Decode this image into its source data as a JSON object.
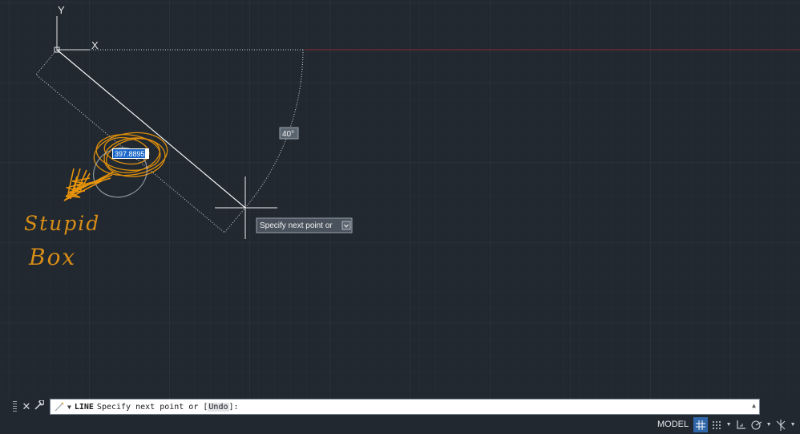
{
  "drawing": {
    "y_axis_label": "Y",
    "x_axis_label": "X",
    "angle_label": "40°",
    "length_input_value": "397.8895",
    "tooltip_text": "Specify next point or",
    "tooltip_icon": "arrow-down-icon",
    "annotation_line1": "Stupid",
    "annotation_line2": "Box",
    "annotation_color": "#e8940a"
  },
  "command_line": {
    "close_icon": "close-icon",
    "customize_icon": "wrench-icon",
    "command_icon": "pen-icon",
    "keyword": "LINE",
    "prompt": "Specify next point or [",
    "option": "Undo",
    "prompt_end": "]:"
  },
  "status_bar": {
    "model_label": "MODEL",
    "icons": [
      "grid-icon",
      "snap-icon",
      "ortho-icon",
      "polar-icon",
      "osnap-icon"
    ]
  },
  "colors": {
    "background": "#212830",
    "grid": "#2c3540",
    "accent": "#2f66a8",
    "red_axis": "#8b2b2b"
  }
}
